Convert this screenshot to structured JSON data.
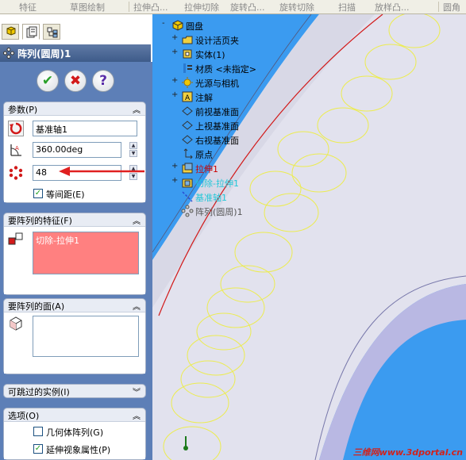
{
  "toolbar": {
    "items": [
      "特征",
      "草图绘制",
      "拉伸凸...",
      "拉伸切除",
      "旋转凸...",
      "旋转切除",
      "扫描",
      "放样凸...",
      "圆角"
    ]
  },
  "property_manager": {
    "tabs": [
      "feature-manager-tab",
      "property-manager-tab",
      "configuration-manager-tab"
    ],
    "title": "阵列(圆周)1",
    "ok_button": "✔",
    "cancel_button": "✖",
    "help_button": "?",
    "parameters": {
      "header": "参数(P)",
      "axis_value": "基准轴1",
      "angle_value": "360.00deg",
      "instances_value": "48",
      "equal_spacing_label": "等间距(E)",
      "equal_spacing_checked": true
    },
    "features_to_pattern": {
      "header": "要阵列的特征(F)",
      "items": [
        "切除-拉伸1"
      ]
    },
    "faces_to_pattern": {
      "header": "要阵列的面(A)"
    },
    "skip_instances": {
      "header": "可跳过的实例(I)"
    },
    "options": {
      "header": "选项(O)",
      "geometry_pattern_label": "几何体阵列(G)",
      "geometry_pattern_checked": false,
      "propagate_visual_label": "延伸视象属性(P)",
      "propagate_visual_checked": true
    }
  },
  "feature_tree": {
    "root": "圆盘",
    "nodes": [
      {
        "label": "设计活页夹",
        "expand": "+",
        "icon": "folder-icon",
        "color": "#000000"
      },
      {
        "label": "实体(1)",
        "expand": "+",
        "icon": "solid-body-icon",
        "color": "#000000"
      },
      {
        "label": "材质 <未指定>",
        "expand": "",
        "icon": "material-icon",
        "color": "#000000"
      },
      {
        "label": "光源与相机",
        "expand": "+",
        "icon": "lights-icon",
        "color": "#000000"
      },
      {
        "label": "注解",
        "expand": "+",
        "icon": "annotation-icon",
        "color": "#000000"
      },
      {
        "label": "前视基准面",
        "expand": "",
        "icon": "plane-icon",
        "color": "#000000"
      },
      {
        "label": "上视基准面",
        "expand": "",
        "icon": "plane-icon",
        "color": "#000000"
      },
      {
        "label": "右视基准面",
        "expand": "",
        "icon": "plane-icon",
        "color": "#000000"
      },
      {
        "label": "原点",
        "expand": "",
        "icon": "origin-icon",
        "color": "#000000"
      },
      {
        "label": "拉伸1",
        "expand": "+",
        "icon": "extrude-icon",
        "color": "#cc0000"
      },
      {
        "label": "切除-拉伸1",
        "expand": "+",
        "icon": "cut-extrude-icon",
        "color": "#22c7d8"
      },
      {
        "label": "基准轴1",
        "expand": "",
        "icon": "axis-icon",
        "color": "#22c7d8"
      },
      {
        "label": "阵列(圆周)1",
        "expand": "",
        "icon": "circular-pattern-icon",
        "color": "#555555"
      }
    ]
  },
  "watermark": "三维网www.3dportal.cn"
}
